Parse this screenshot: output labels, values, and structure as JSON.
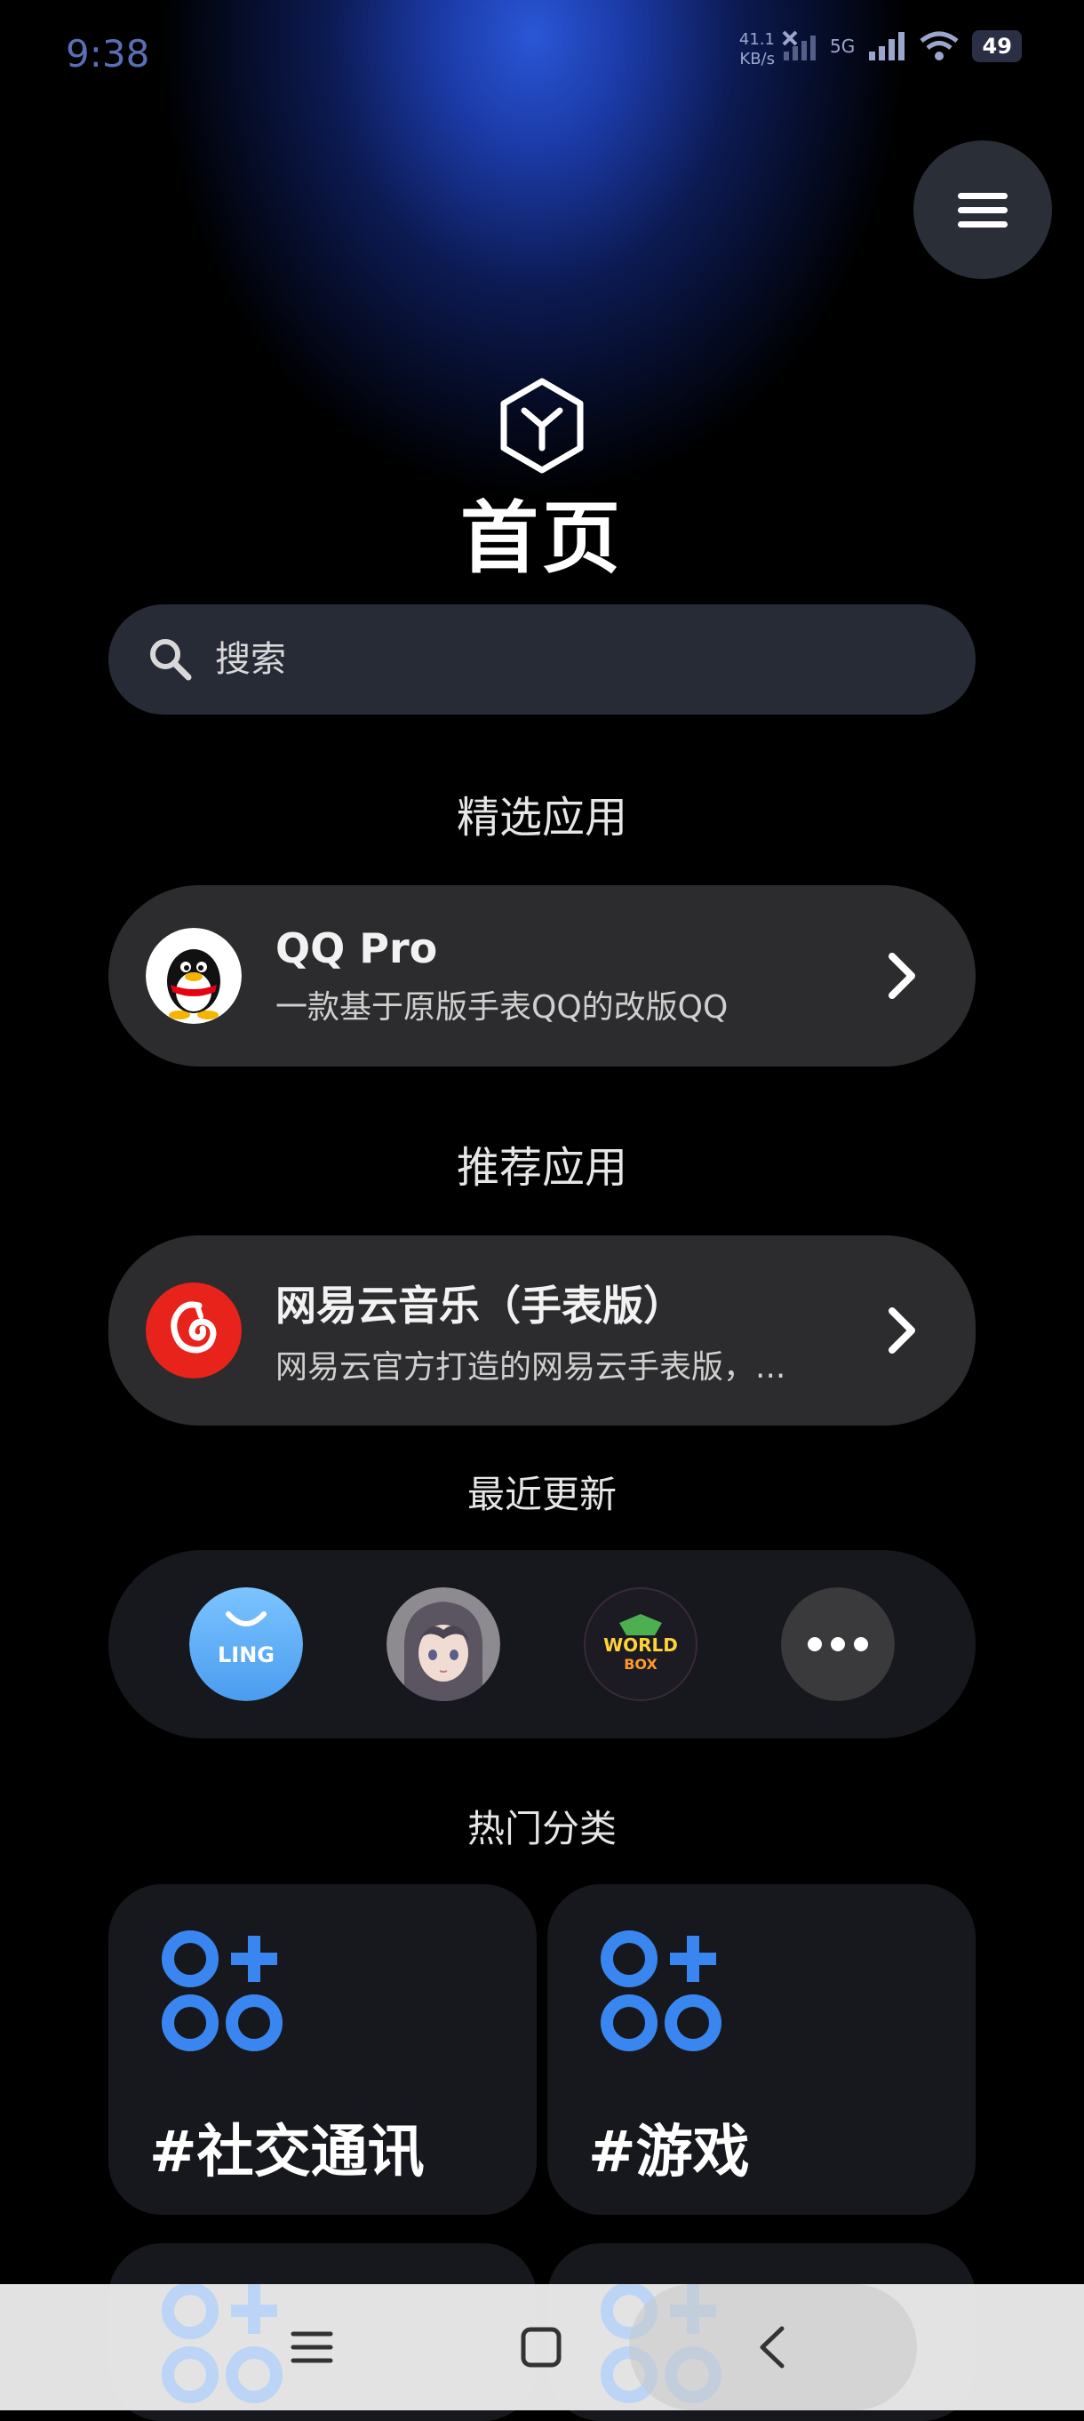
{
  "status_bar": {
    "time": "9:38",
    "net_speed_value": "41.1",
    "net_speed_unit": "KB/s",
    "network": "5G",
    "battery": "49"
  },
  "page": {
    "title": "首页"
  },
  "search": {
    "placeholder": "搜索"
  },
  "featured": {
    "section_title": "精选应用",
    "app": {
      "name": "QQ Pro",
      "description": "一款基于原版手表QQ的改版QQ"
    }
  },
  "recommended": {
    "section_title": "推荐应用",
    "app": {
      "name": "网易云音乐（手表版）",
      "description": "网易云官方打造的网易云手表版，..."
    }
  },
  "recent": {
    "section_title": "最近更新",
    "items": [
      {
        "label": "LING",
        "icon": "ling-app-icon"
      },
      {
        "label": "",
        "icon": "anime-avatar-icon"
      },
      {
        "label": "WORLD BOX",
        "icon": "worldbox-icon"
      },
      {
        "label": "",
        "icon": "more-icon"
      }
    ]
  },
  "categories": {
    "section_title": "热门分类",
    "items": [
      {
        "label": "#社交通讯"
      },
      {
        "label": "#游戏"
      }
    ]
  },
  "colors": {
    "accent": "#3a86f0",
    "card": "#2c2c2e",
    "search_bg": "#272b35"
  }
}
